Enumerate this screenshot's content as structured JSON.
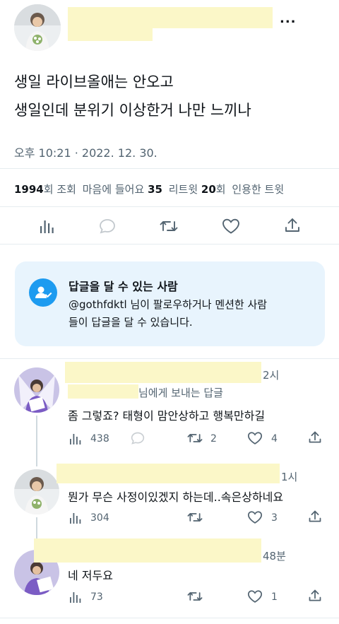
{
  "tweet": {
    "more_label": "...",
    "text_line1": "생일 라이브올애는 안오고",
    "text_line2": "생일인데 분위기 이상한거 나만 느끼나",
    "timestamp": "오후 10:21 · 2022. 12. 30.",
    "stats": {
      "views": "1994",
      "views_label": "회 조회",
      "likes_label": "마음에 들어요",
      "likes": "35",
      "retweets_label": "리트윗",
      "retweets": "20",
      "retweets_unit": "회",
      "quotes_label": "인용한 트윗"
    }
  },
  "reply_restriction": {
    "title": "답글을 달 수 있는 사람",
    "line1": "@gothfdktl 님이 팔로우하거나 멘션한 사람",
    "line2": "들이 답글을 달 수 있습니다."
  },
  "replies": [
    {
      "time": "2시",
      "replying_to": "님에게 보내는 답글",
      "text": "좀 그렇죠? 태형이 맘안상하고 행복만하길",
      "views": "438",
      "retweets": "2",
      "likes": "4"
    },
    {
      "time": "1시",
      "text": "뭔가 무슨 사정이있겠지 하는데..속은상하네요",
      "views": "304",
      "likes": "3"
    },
    {
      "time": "48분",
      "text": "네 저두요",
      "views": "73",
      "likes": "1"
    }
  ],
  "colors": {
    "text": "#0f1419",
    "muted": "#536471",
    "accent": "#1d9bf0",
    "info_bg": "#e8f4fd",
    "highlight": "#fbf7c8"
  },
  "icons": [
    "views-icon",
    "reply-icon",
    "retweet-icon",
    "like-icon",
    "share-icon",
    "people-icon"
  ]
}
